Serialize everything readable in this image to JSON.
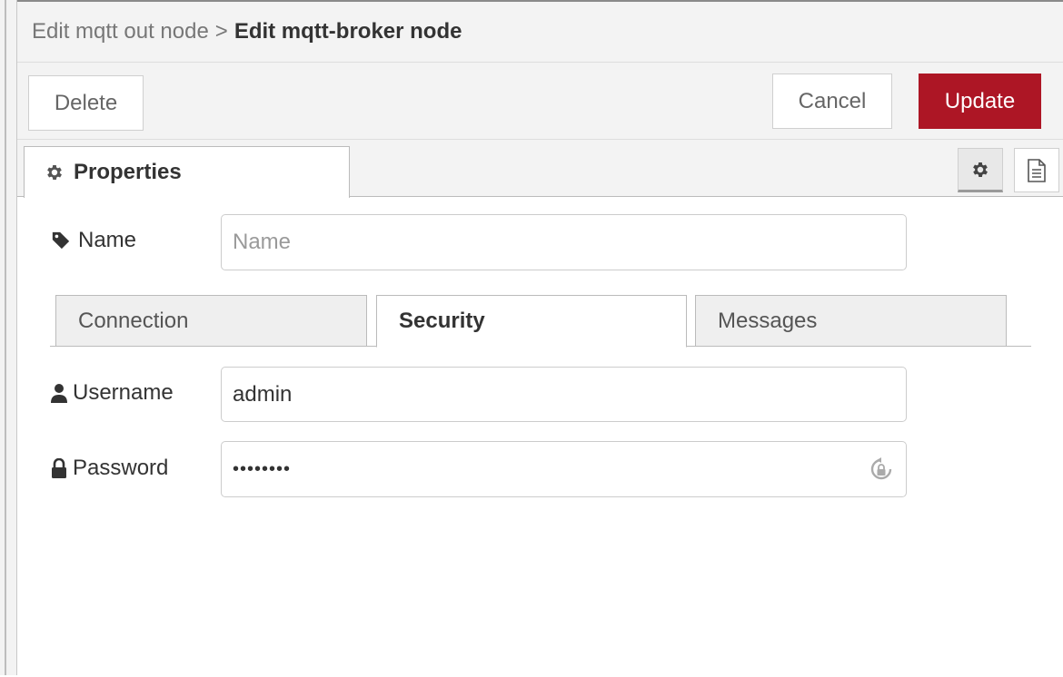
{
  "breadcrumb": {
    "previous": "Edit mqtt out node",
    "separator": ">",
    "current": "Edit mqtt-broker node"
  },
  "toolbar": {
    "delete_label": "Delete",
    "cancel_label": "Cancel",
    "update_label": "Update"
  },
  "tabs": {
    "properties_label": "Properties"
  },
  "form": {
    "name_label": "Name",
    "name_placeholder": "Name",
    "name_value": "",
    "username_label": "Username",
    "username_value": "admin",
    "password_label": "Password",
    "password_value": "••••••••"
  },
  "subtabs": [
    {
      "label": "Connection",
      "active": false
    },
    {
      "label": "Security",
      "active": true
    },
    {
      "label": "Messages",
      "active": false
    }
  ],
  "colors": {
    "accent": "#ad1625",
    "tray_background": "#f3f3f3"
  },
  "icons": {
    "properties_tab": "gear-icon",
    "settings_button": "gear-icon",
    "info_button": "document-icon",
    "name": "tag-icon",
    "username": "user-icon",
    "password": "lock-icon",
    "password_toggle": "lock-rotate-icon"
  }
}
